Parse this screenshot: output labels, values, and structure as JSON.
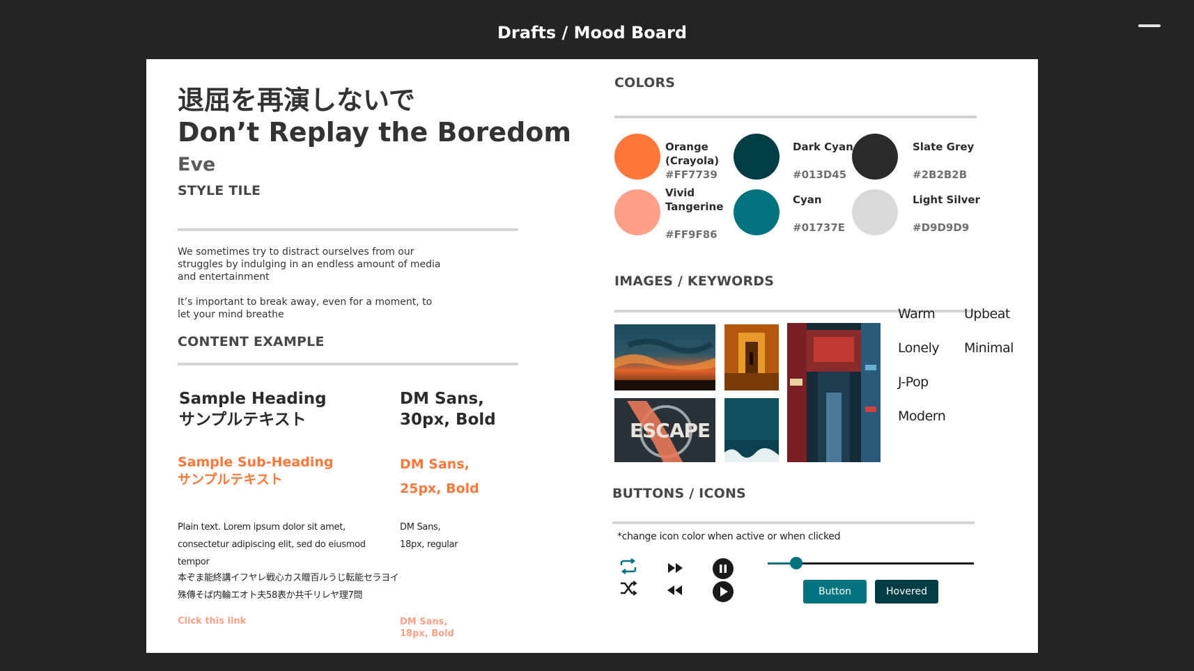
{
  "window": {
    "title": "Drafts / Mood Board"
  },
  "header": {
    "title_jp": "退屈を再演しないで",
    "title_en": "Don’t Replay the Boredom",
    "author": "Eve"
  },
  "style_tile": {
    "heading": "STYLE TILE",
    "paragraph1": "We sometimes try to distract ourselves from our struggles by indulging in an endless amount of media and entertainment",
    "paragraph2": "It’s important to break away, even for a moment, to let your mind breathe"
  },
  "content_example": {
    "heading": "CONTENT EXAMPLE",
    "sample_heading": [
      "Sample Heading",
      "サンプルテキスト"
    ],
    "sample_heading_spec": "DM Sans, 30px, Bold",
    "sample_subheading": [
      "Sample Sub-Heading",
      "サンプルテキスト"
    ],
    "sample_subheading_spec": [
      "DM Sans,",
      "25px, Bold"
    ],
    "plain_text": "Plain text. Lorem ipsum dolor sit amet, consectetur adipiscing elit, sed do eiusmod tempor",
    "plain_text_spec": [
      "DM Sans,",
      "18px, regular"
    ],
    "jp_text": "本ぞま能終講イフヤレ戦心カス贈百ルうじ転能セラヨイ殊傳そば内輪エオト夫58表か共千リレヤ理7問",
    "link_text": "Click this link",
    "link_spec": [
      "DM Sans,",
      "18px, Bold"
    ]
  },
  "colors": {
    "heading": "COLORS",
    "swatches": [
      {
        "name": [
          "Orange",
          "(Crayola)"
        ],
        "hex": "#FF7739",
        "color": "#FF7739"
      },
      {
        "name": [
          "Dark Cyan"
        ],
        "hex": "#013D45",
        "color": "#013D45"
      },
      {
        "name": [
          "Slate Grey"
        ],
        "hex": "#2B2B2B",
        "color": "#2B2B2B"
      },
      {
        "name": [
          "Vivid",
          "Tangerine"
        ],
        "hex": "#FF9F86",
        "color": "#FF9F86"
      },
      {
        "name": [
          "Cyan"
        ],
        "hex": "#01737E",
        "color": "#01737E"
      },
      {
        "name": [
          "Light Silver"
        ],
        "hex": "#D9D9D9",
        "color": "#D9D9D9"
      }
    ]
  },
  "images": {
    "heading": "IMAGES / KEYWORDS",
    "logo_text": "ESCAPE",
    "keywords": [
      "Warm",
      "Upbeat",
      "Lonely",
      "Minimal",
      "J-Pop",
      "Modern"
    ]
  },
  "buttons": {
    "heading": "BUTTONS / ICONS",
    "note": "*change icon color when active or when clicked",
    "button_label": "Button",
    "hovered_label": "Hovered",
    "slider_value": 0.14,
    "icons": [
      "repeat-icon",
      "shuffle-icon",
      "fast-forward-icon",
      "rewind-icon",
      "pause-icon",
      "play-icon"
    ]
  }
}
